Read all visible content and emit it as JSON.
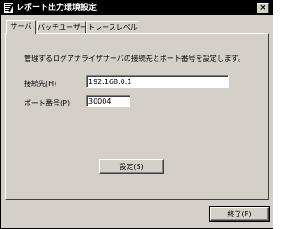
{
  "window": {
    "title": "レポート出力環境設定",
    "close_glyph": "×"
  },
  "tabs": [
    {
      "label": "サーバ",
      "active": true
    },
    {
      "label": "バッチユーザー",
      "active": false
    },
    {
      "label": "トレースレベル",
      "active": false
    }
  ],
  "server_tab": {
    "description": "管理するログアナライザサーバの接続先とポート番号を設定します。",
    "host_label": "接続先(H)",
    "host_value": "192.168.0.1",
    "port_label": "ポート番号(P)",
    "port_value": "30004",
    "set_button": "設定(S)"
  },
  "footer": {
    "exit_button": "終了(E)"
  }
}
